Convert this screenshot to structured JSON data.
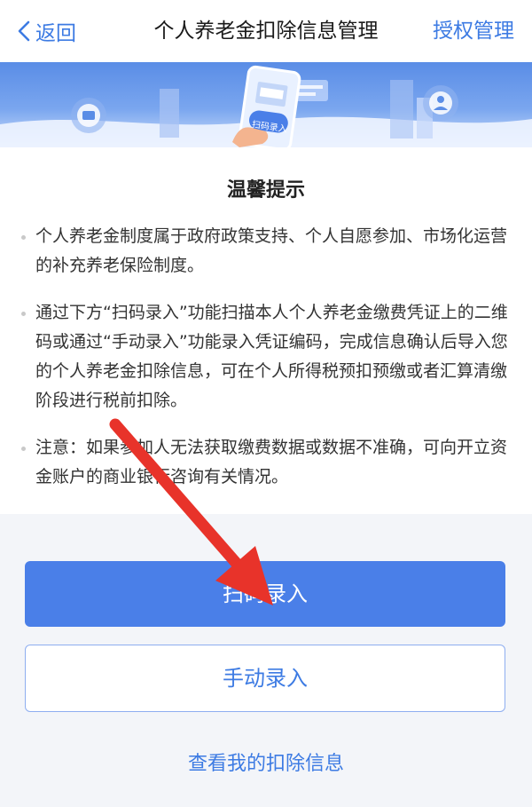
{
  "nav": {
    "back_label": "返回",
    "title": "个人养老金扣除信息管理",
    "auth_label": "授权管理"
  },
  "banner": {
    "phone_label": "扫码录入"
  },
  "tips": {
    "title": "温馨提示",
    "items": [
      {
        "text": "个人养老金制度属于政府政策支持、个人自愿参加、市场化运营的补充养老保险制度。"
      },
      {
        "text": "通过下方“扫码录入”功能扫描本人个人养老金缴费凭证上的二维码或通过“手动录入”功能录入凭证编码，完成信息确认后导入您的个人养老金扣除信息，可在个人所得税预扣预缴或者汇算清缴阶段进行税前扣除。"
      },
      {
        "text": "注意：如果参加人无法获取缴费数据或数据不准确，可向开立资金账户的商业银行咨询有关情况。"
      }
    ]
  },
  "actions": {
    "scan_label": "扫码录入",
    "manual_label": "手动录入",
    "view_label": "查看我的扣除信息"
  },
  "colors": {
    "accent": "#3d7be3",
    "primary_button": "#4a7fe8",
    "annotation_arrow": "#e8332a"
  }
}
